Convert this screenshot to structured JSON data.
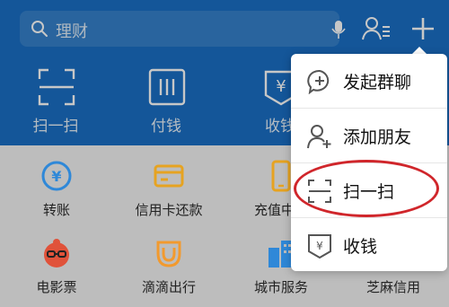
{
  "header": {
    "search": {
      "placeholder": "理财"
    },
    "quick_actions": [
      {
        "label": "扫一扫",
        "icon": "scan-icon"
      },
      {
        "label": "付钱",
        "icon": "barcode-icon"
      },
      {
        "label": "收钱",
        "icon": "yuan-receipt-icon"
      }
    ]
  },
  "grid": {
    "items": [
      {
        "label": "转账",
        "icon": "transfer-icon"
      },
      {
        "label": "信用卡还款",
        "icon": "credit-card-icon"
      },
      {
        "label": "充值中心",
        "icon": "phone-topup-icon"
      },
      {
        "label": "电影票",
        "icon": "movie-ticket-icon"
      },
      {
        "label": "滴滴出行",
        "icon": "didi-icon"
      },
      {
        "label": "城市服务",
        "icon": "city-service-icon"
      },
      {
        "label": "芝麻信用",
        "icon": "sesame-credit-icon"
      }
    ]
  },
  "menu": {
    "items": [
      {
        "label": "发起群聊",
        "icon": "group-chat-icon"
      },
      {
        "label": "添加朋友",
        "icon": "add-friend-icon"
      },
      {
        "label": "扫一扫",
        "icon": "scan-icon"
      },
      {
        "label": "收钱",
        "icon": "yuan-receipt-icon"
      }
    ],
    "highlighted_item": "扫一扫"
  },
  "colors": {
    "header_blue": "#1a6fc4",
    "highlight_red": "#d0262b",
    "transfer_blue": "#2f88d8",
    "card_orange": "#e6a321",
    "movie_red": "#e0523a",
    "didi_orange": "#f29a2e"
  }
}
